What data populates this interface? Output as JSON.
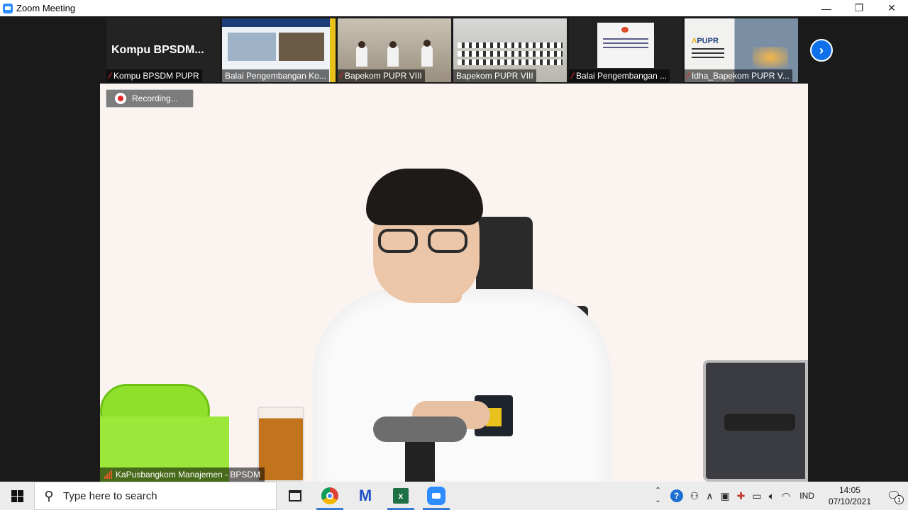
{
  "window": {
    "title": "Zoom Meeting",
    "minimize_glyph": "—",
    "maximize_glyph": "❐",
    "close_glyph": "✕"
  },
  "thumbnails": [
    {
      "name": "Kompu BPSDM PUPR",
      "display_name": "Kompu  BPSDM...",
      "muted": true
    },
    {
      "name": "Balai Pengembangan Ko...",
      "muted": false
    },
    {
      "name": "Bapekom PUPR VIII",
      "muted": true
    },
    {
      "name": "Bapekom PUPR VIII",
      "muted": false
    },
    {
      "name": "Balai Pengembangan ...",
      "muted": true
    },
    {
      "name": "Idha_Bapekom PUPR V...",
      "muted": true
    }
  ],
  "next_glyph": "›",
  "recording_label": "Recording...",
  "active_speaker": "KaPusbangkom Manajemen - BPSDM",
  "pupr_logo": {
    "prefix": "Ʌ",
    "text": "PUPR"
  },
  "taskbar": {
    "search_placeholder": "Type here to search",
    "excel_letter": "x",
    "language": "IND",
    "time": "14:05",
    "date": "07/10/2021",
    "notification_count": "1"
  },
  "icons": {
    "mic_muted": "mic-muted-icon",
    "search": "search-icon",
    "help": "?"
  },
  "colors": {
    "zoom_blue": "#2d8cff",
    "muted_red": "#e02828",
    "next_button": "#0e71eb"
  }
}
